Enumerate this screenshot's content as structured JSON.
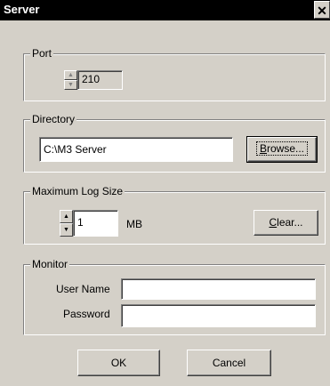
{
  "window": {
    "title": "Server",
    "close_glyph": "✕"
  },
  "port": {
    "legend": "Port",
    "value": "210"
  },
  "directory": {
    "legend": "Directory",
    "value": "C:\\M3 Server",
    "browse_pre": "",
    "browse_ul": "B",
    "browse_post": "rowse..."
  },
  "log": {
    "legend": "Maximum Log Size",
    "value": "1",
    "unit": "MB",
    "clear_ul": "C",
    "clear_post": "lear..."
  },
  "monitor": {
    "legend": "Monitor",
    "username_label": "User Name",
    "username_value": "",
    "password_label": "Password",
    "password_value": ""
  },
  "footer": {
    "ok_label": "OK",
    "cancel_label": "Cancel"
  },
  "icons": {
    "spin_up": "▲",
    "spin_down": "▼"
  }
}
